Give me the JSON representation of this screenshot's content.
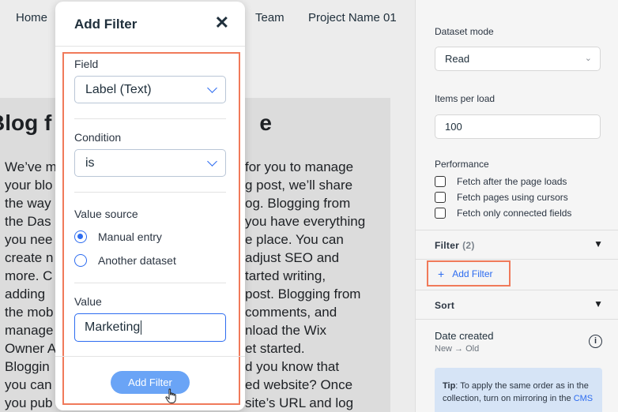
{
  "nav": {
    "items": [
      "Home",
      "Team",
      "Project Name 01"
    ]
  },
  "blog": {
    "title": "Blog f",
    "title_tail": "e",
    "lines": [
      {
        "left": "We’ve m",
        "right": "for you to manage"
      },
      {
        "left": "your blo",
        "right": "g post, we’ll share"
      },
      {
        "left": "the way",
        "right": "og. Blogging from"
      },
      {
        "left": "the Das",
        "right": "you have everything"
      },
      {
        "left": "you nee",
        "right": "e place. You can"
      },
      {
        "left": "create n",
        "right": "adjust SEO and"
      },
      {
        "left": "more. C",
        "right": "tarted writing,"
      },
      {
        "left": "adding",
        "right": "post. Blogging from"
      },
      {
        "left": "the mob",
        "right": "comments, and"
      },
      {
        "left": "manage",
        "right": "nload the Wix"
      },
      {
        "left": "Owner A",
        "right": "et started."
      },
      {
        "left": "Bloggin",
        "right": "d you know that"
      },
      {
        "left": "you can",
        "right": "ed website? Once"
      },
      {
        "left": "you pub",
        "right": "site’s URL and log"
      }
    ]
  },
  "settings": {
    "dataset_mode_label": "Dataset mode",
    "dataset_mode_value": "Read",
    "items_per_load_label": "Items per load",
    "items_per_load_value": "100",
    "performance_label": "Performance",
    "performance_options": [
      "Fetch after the page loads",
      "Fetch pages using cursors",
      "Fetch only connected fields"
    ],
    "filter_label": "Filter",
    "filter_count": "(2)",
    "add_filter_label": "Add Filter",
    "sort_label": "Sort",
    "sort_field": "Date created",
    "sort_order": "New → Old",
    "tip_bold": "Tip",
    "tip_text": ": To apply the same order as in the collection, turn on mirroring in the ",
    "tip_link": "CMS"
  },
  "modal": {
    "title": "Add Filter",
    "field_label": "Field",
    "field_value": "Label (Text)",
    "condition_label": "Condition",
    "condition_value": "is",
    "value_source_label": "Value source",
    "value_source_options": [
      "Manual entry",
      "Another dataset"
    ],
    "value_source_selected": "Manual entry",
    "value_label": "Value",
    "value_input": "Marketing",
    "add_button": "Add Filter"
  },
  "colors": {
    "accent": "#2d6cf0",
    "highlight": "#f07a5a",
    "button": "#6aa4f6"
  }
}
